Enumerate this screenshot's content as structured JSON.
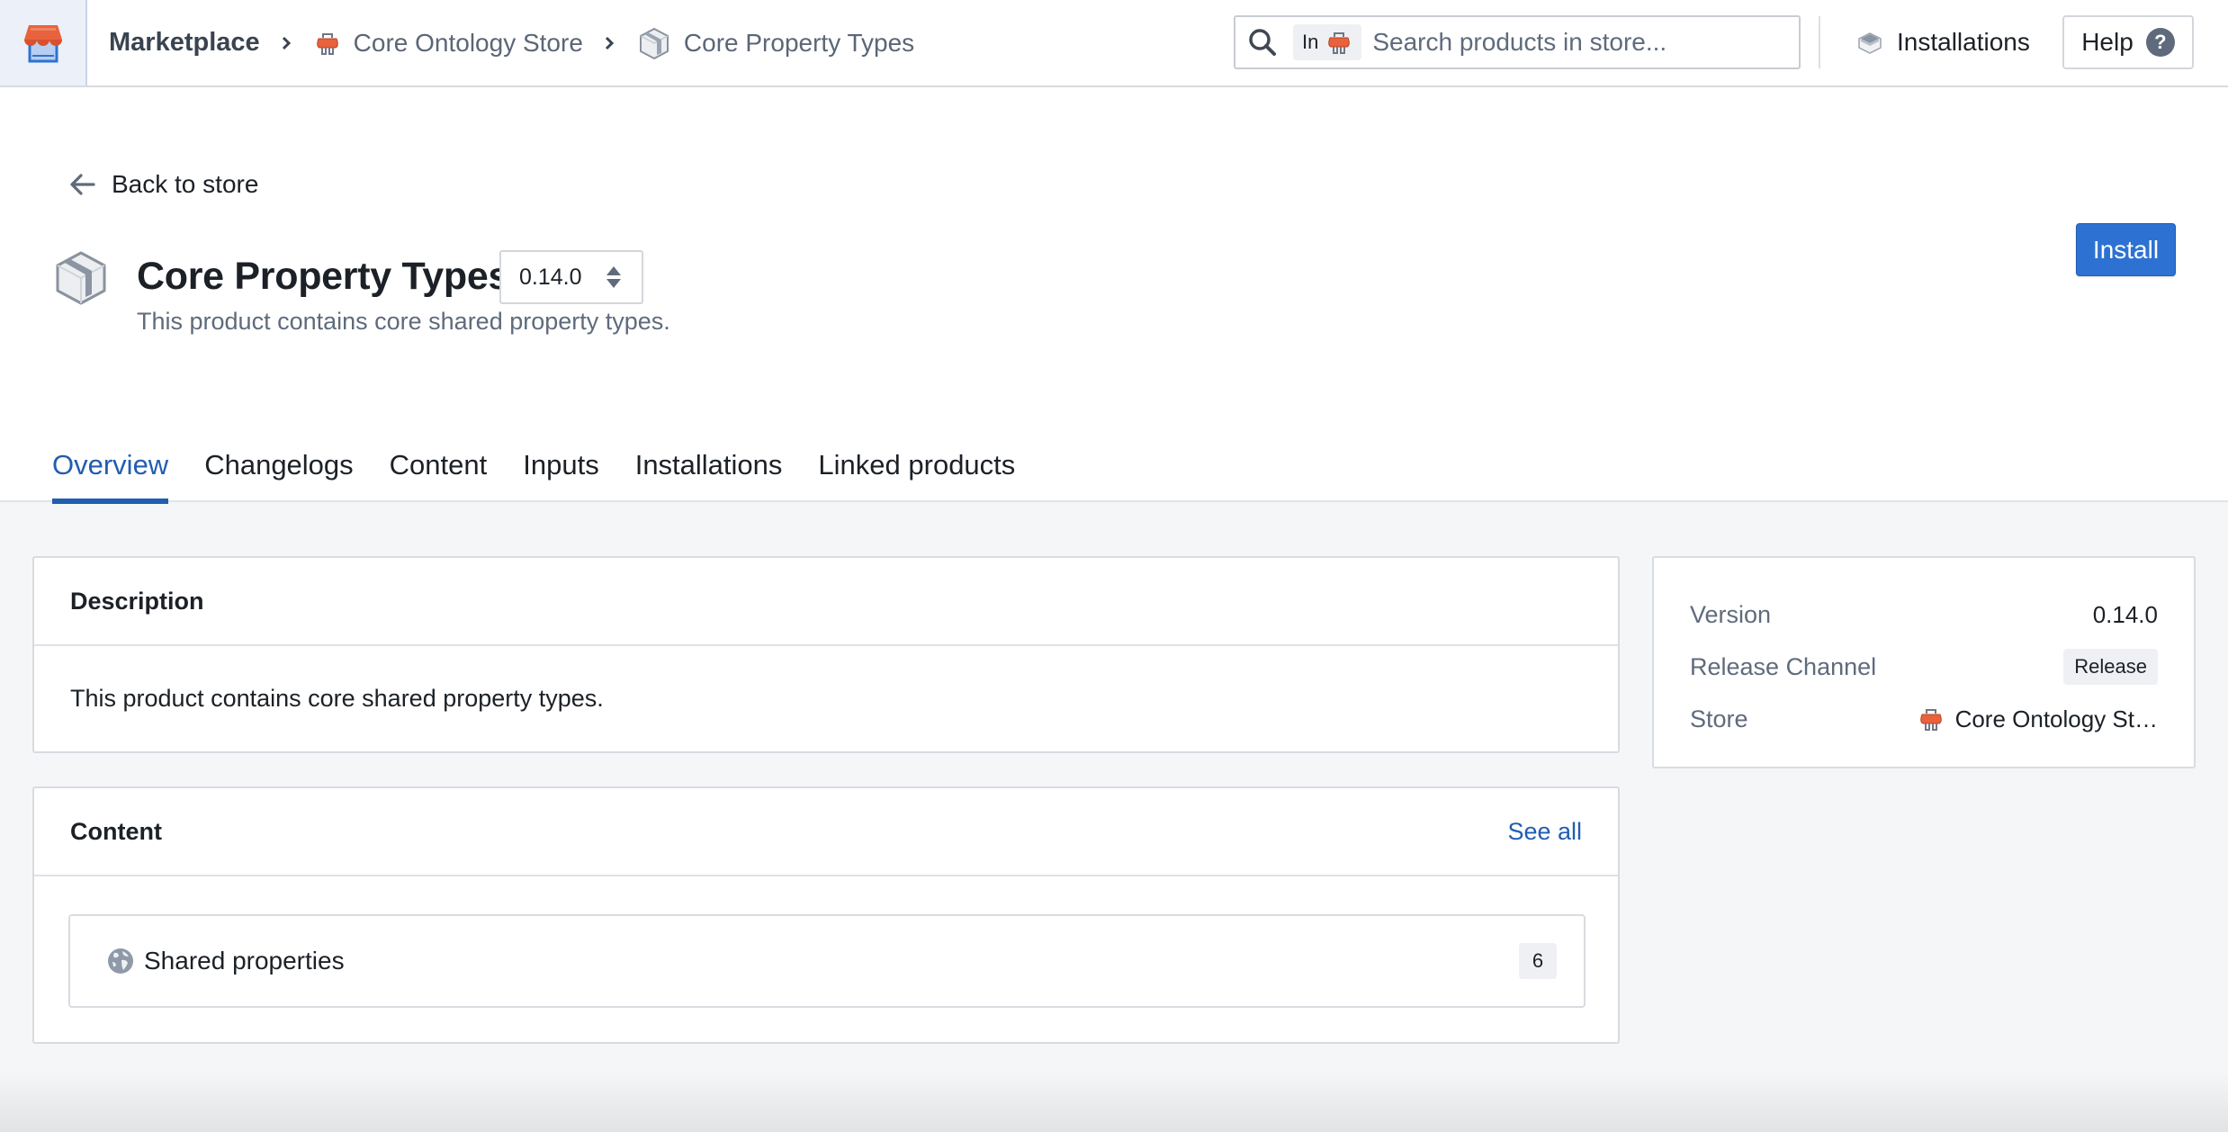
{
  "header": {
    "app_icon": "storefront-icon",
    "breadcrumb": {
      "root": "Marketplace",
      "items": [
        {
          "label": "Core Ontology Store",
          "icon": "store-plug-icon"
        },
        {
          "label": "Core Property Types",
          "icon": "package-box-icon"
        }
      ]
    },
    "search": {
      "scope_prefix": "In",
      "scope_icon": "store-plug-icon",
      "value": "",
      "placeholder": "Search products in store..."
    },
    "installations_label": "Installations",
    "help_label": "Help",
    "help_icon_glyph": "?"
  },
  "product": {
    "back_label": "Back to store",
    "title": "Core Property Types",
    "version": "0.14.0",
    "subtitle": "This product contains core shared property types.",
    "install_label": "Install",
    "accent_color": "#2d72d2"
  },
  "tabs": [
    {
      "label": "Overview",
      "active": true
    },
    {
      "label": "Changelogs",
      "active": false
    },
    {
      "label": "Content",
      "active": false
    },
    {
      "label": "Inputs",
      "active": false
    },
    {
      "label": "Installations",
      "active": false
    },
    {
      "label": "Linked products",
      "active": false
    }
  ],
  "description_card": {
    "title": "Description",
    "body": "This product contains core shared property types."
  },
  "content_card": {
    "title": "Content",
    "see_all_label": "See all",
    "items": [
      {
        "label": "Shared properties",
        "icon": "globe-icon",
        "count": "6"
      }
    ]
  },
  "info_card": {
    "version_label": "Version",
    "version_value": "0.14.0",
    "channel_label": "Release Channel",
    "channel_value": "Release",
    "store_label": "Store",
    "store_value": "Core Ontology St…"
  }
}
